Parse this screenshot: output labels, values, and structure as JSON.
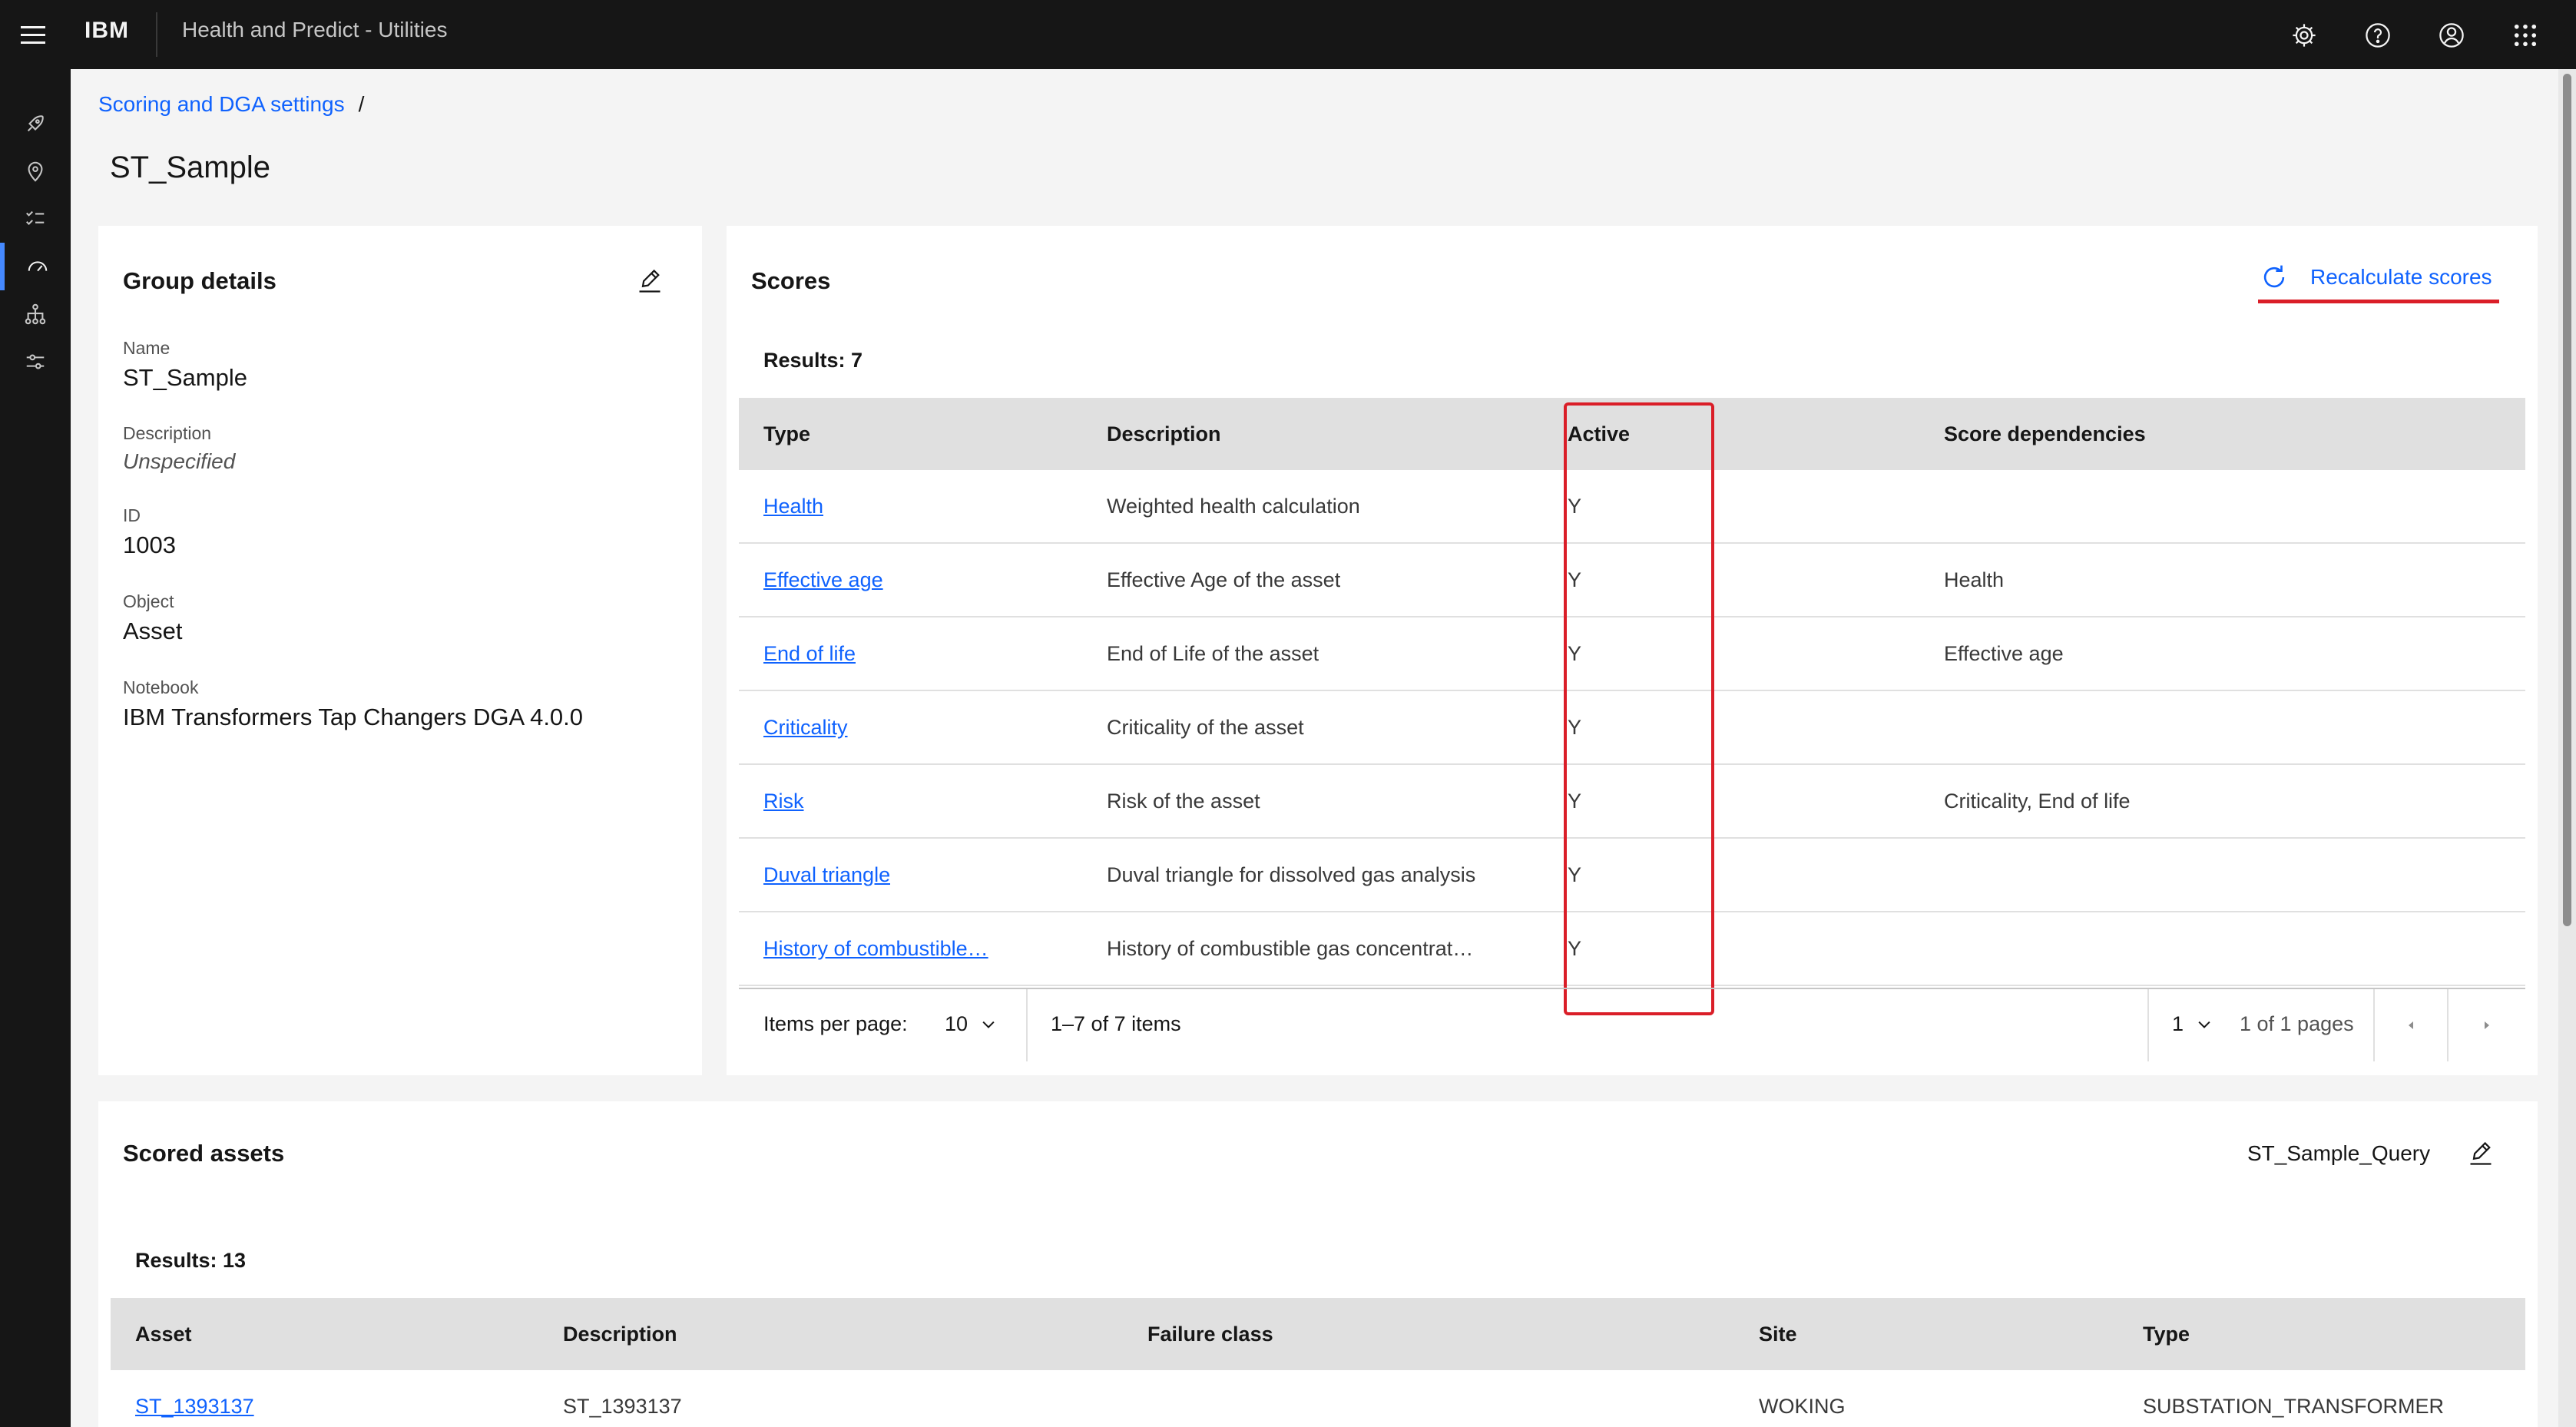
{
  "header": {
    "brand": "IBM",
    "app_title": "Health and Predict - Utilities"
  },
  "breadcrumb": {
    "link_label": "Scoring and DGA settings",
    "separator": "/"
  },
  "page_title": "ST_Sample",
  "group_details": {
    "title": "Group details",
    "fields": [
      {
        "label": "Name",
        "value": "ST_Sample"
      },
      {
        "label": "Description",
        "value": "Unspecified"
      },
      {
        "label": "ID",
        "value": "1003"
      },
      {
        "label": "Object",
        "value": "Asset"
      },
      {
        "label": "Notebook",
        "value": "IBM Transformers Tap Changers DGA 4.0.0"
      }
    ]
  },
  "scores": {
    "title": "Scores",
    "recalculate_label": "Recalculate scores",
    "results_label": "Results: 7",
    "columns": [
      "Type",
      "Description",
      "Active",
      "Score dependencies"
    ],
    "rows": [
      {
        "type": "Health",
        "description": "Weighted health calculation",
        "active": "Y",
        "dependencies": ""
      },
      {
        "type": "Effective age",
        "description": "Effective Age of the asset",
        "active": "Y",
        "dependencies": "Health"
      },
      {
        "type": "End of life",
        "description": "End of Life of the asset",
        "active": "Y",
        "dependencies": "Effective age"
      },
      {
        "type": "Criticality",
        "description": "Criticality of the asset",
        "active": "Y",
        "dependencies": ""
      },
      {
        "type": "Risk",
        "description": "Risk of the asset",
        "active": "Y",
        "dependencies": "Criticality, End of life"
      },
      {
        "type": "Duval triangle",
        "description": "Duval triangle for dissolved gas analysis",
        "active": "Y",
        "dependencies": ""
      },
      {
        "type": "History of combustible…",
        "description": "History of combustible gas concentrat…",
        "active": "Y",
        "dependencies": ""
      }
    ],
    "pagination": {
      "items_per_page_label": "Items per page:",
      "items_per_page": "10",
      "range": "1–7 of 7 items",
      "page": "1",
      "page_total": "1 of 1 pages"
    }
  },
  "scored_assets": {
    "title": "Scored assets",
    "query_name": "ST_Sample_Query",
    "results_label": "Results: 13",
    "columns": [
      "Asset",
      "Description",
      "Failure class",
      "Site",
      "Type"
    ],
    "rows": [
      {
        "asset": "ST_1393137",
        "description": "ST_1393137",
        "failure_class": "",
        "site": "WOKING",
        "type": "SUBSTATION_TRANSFORMER"
      }
    ]
  },
  "colors": {
    "header_bg": "#161616",
    "link": "#0f62fe",
    "highlight": "#da1e28"
  }
}
